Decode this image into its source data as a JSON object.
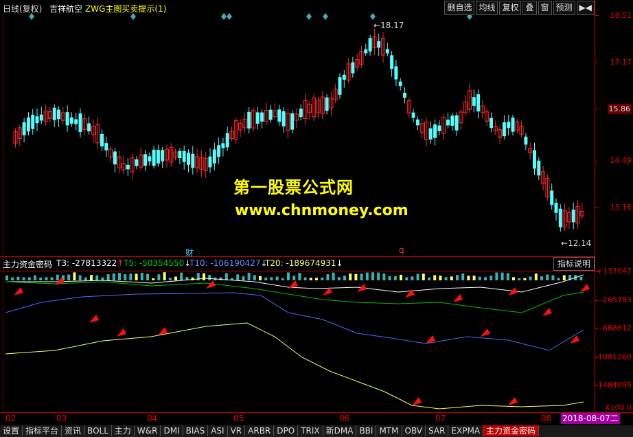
{
  "topbar": {
    "period": "日线(复权)",
    "stock": "吉祥航空",
    "indicator": "ZWG主图买卖提示(1)",
    "buttons": [
      "删自选",
      "均线",
      "复权",
      "叠",
      "窗",
      "预测"
    ],
    "nav_icon": "play-back-icon"
  },
  "main_chart": {
    "y_ticks": [
      "18.51",
      "17.17",
      "15.86",
      "14.49",
      "13.16"
    ],
    "highlighted_price": "15.86",
    "high_label": "18.17",
    "low_label": "12.14",
    "markers": [
      "财",
      "q"
    ]
  },
  "watermark": {
    "line1": "第一股票公式网",
    "line2": "www.chnmoney.com"
  },
  "indicator_panel": {
    "name": "主力资金密码",
    "t3": "T3: -27813322",
    "t5": "T5: -50354550",
    "t10": "T10: -106190427",
    "t20": "T20: -189674931",
    "explain_button": "指标说明",
    "y_ticks": [
      "137047",
      "-265783",
      "-668612",
      "-1081260",
      "-1484095"
    ],
    "unit": "X100.0"
  },
  "x_axis": {
    "labels": [
      "02",
      "03",
      "04",
      "05",
      "06",
      "07",
      "08"
    ],
    "current_date": "2018-08-07二"
  },
  "tabs": [
    "设置",
    "指标平台",
    "资讯",
    "BOLL",
    "主力",
    "W&R",
    "DMI",
    "BIAS",
    "ASI",
    "VR",
    "ARBR",
    "DPO",
    "TRIX",
    "新DMA",
    "BBI",
    "MTM",
    "OBV",
    "SAR",
    "EXPMA",
    "主力资金密码"
  ],
  "colors": {
    "up": "#ff2a2a",
    "down": "#54ffff",
    "t3": "#ffffff",
    "t5": "#00c000",
    "t10": "#4a6bff",
    "t20": "#ffff60",
    "axis": "#cc0000"
  }
}
